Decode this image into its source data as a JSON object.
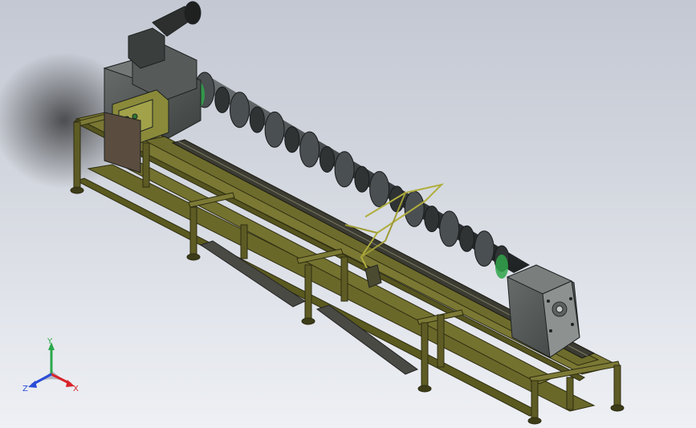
{
  "viewport": {
    "background_top": "#c3c8d3",
    "background_bottom": "#eef0f4"
  },
  "model": {
    "frame_color": "#6b6a2e",
    "frame_dark": "#3c3b1a",
    "housing_color": "#4f5352",
    "crankshaft_color": "#3a3e40",
    "panel_color": "#8a8a3a",
    "accent_green": "#2fa34a"
  },
  "triad": {
    "x_label": "X",
    "y_label": "Y",
    "z_label": "Z",
    "x_color": "#d8232a",
    "y_color": "#2aa84a",
    "z_color": "#2a4cd8"
  }
}
